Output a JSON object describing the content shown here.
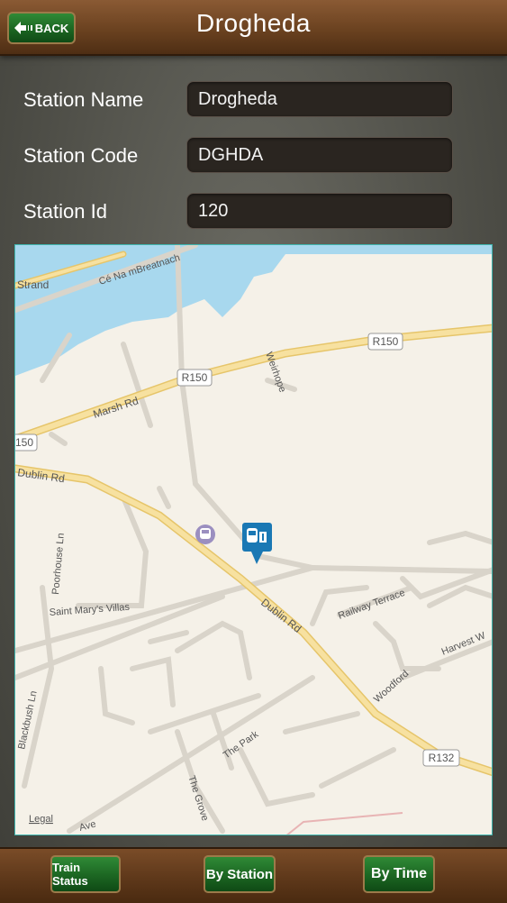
{
  "header": {
    "back_label": "BACK",
    "title": "Drogheda"
  },
  "form": {
    "station_name_label": "Station Name",
    "station_name_value": "Drogheda",
    "station_code_label": "Station Code",
    "station_code_value": "DGHDA",
    "station_id_label": "Station Id",
    "station_id_value": "120"
  },
  "map": {
    "legal": "Legal",
    "road_labels": {
      "strand": "Strand",
      "ce_na_mbreatnach": "Cé Na mBreatnach",
      "r150_a": "R150",
      "r150_b": "R150",
      "r150_c": "150",
      "marsh_rd": "Marsh Rd",
      "weirhope": "Weirhope",
      "dublin_rd_a": "Dublin Rd",
      "dublin_rd_b": "Dublin Rd",
      "poorhouse_ln": "Poorhouse Ln",
      "saint_marys_villas": "Saint Mary's Villas",
      "railway_terrace": "Railway Terrace",
      "woodford": "Woodford",
      "harvest_w": "Harvest W",
      "blackbush_ln": "Blackbush Ln",
      "the_park": "The Park",
      "the_grove": "The Grove",
      "ave": "Ave",
      "r132": "R132"
    },
    "colors": {
      "water": "#a8d8ee",
      "land": "#f5f1e8",
      "major_road": "#f5d98a",
      "pin": "#1a78b4",
      "poi": "#9b8fc0"
    }
  },
  "footer": {
    "train_status": "Train Status",
    "by_station": "By Station",
    "by_time": "By Time"
  },
  "icons": [
    "back-arrow-icon",
    "station-pin-icon",
    "train-poi-icon"
  ]
}
